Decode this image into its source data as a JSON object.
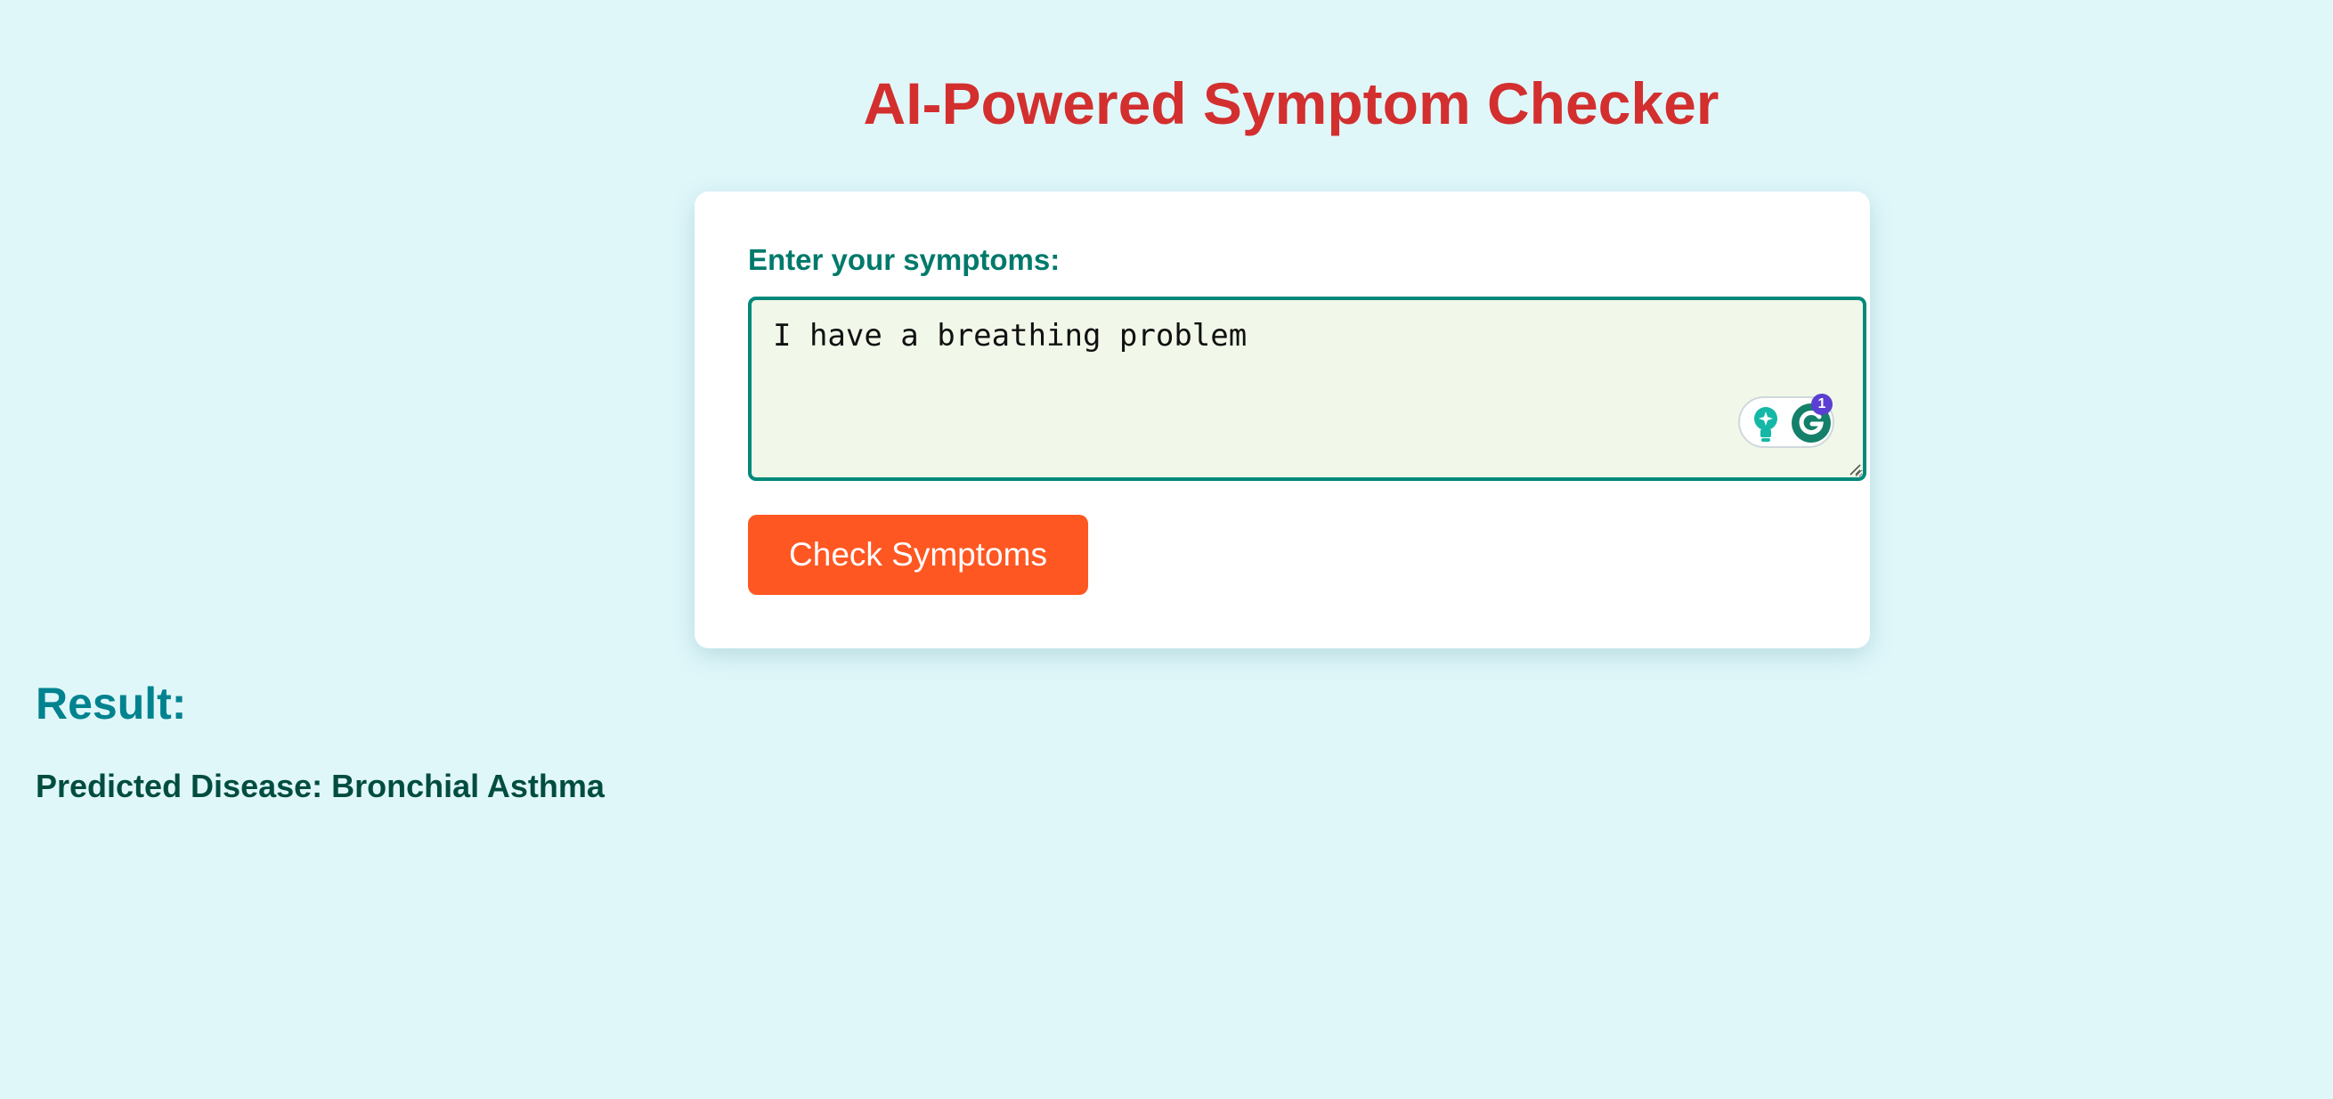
{
  "header": {
    "title": "AI-Powered Symptom Checker"
  },
  "form": {
    "label": "Enter your symptoms:",
    "input_value": "I have a breathing problem",
    "button_label": "Check Symptoms"
  },
  "assistant_widget": {
    "suggestion_icon": "lightbulb-icon",
    "brand_icon": "grammarly-icon",
    "badge_count": "1"
  },
  "result": {
    "heading": "Result:",
    "text": "Predicted Disease: Bronchial Asthma"
  },
  "colors": {
    "background": "#e0f7fa",
    "title": "#d32f2f",
    "label": "#00796b",
    "input_border": "#00897b",
    "input_background": "#f1f8e9",
    "button": "#ff5722",
    "result_heading": "#00838f",
    "result_text": "#004d40"
  }
}
